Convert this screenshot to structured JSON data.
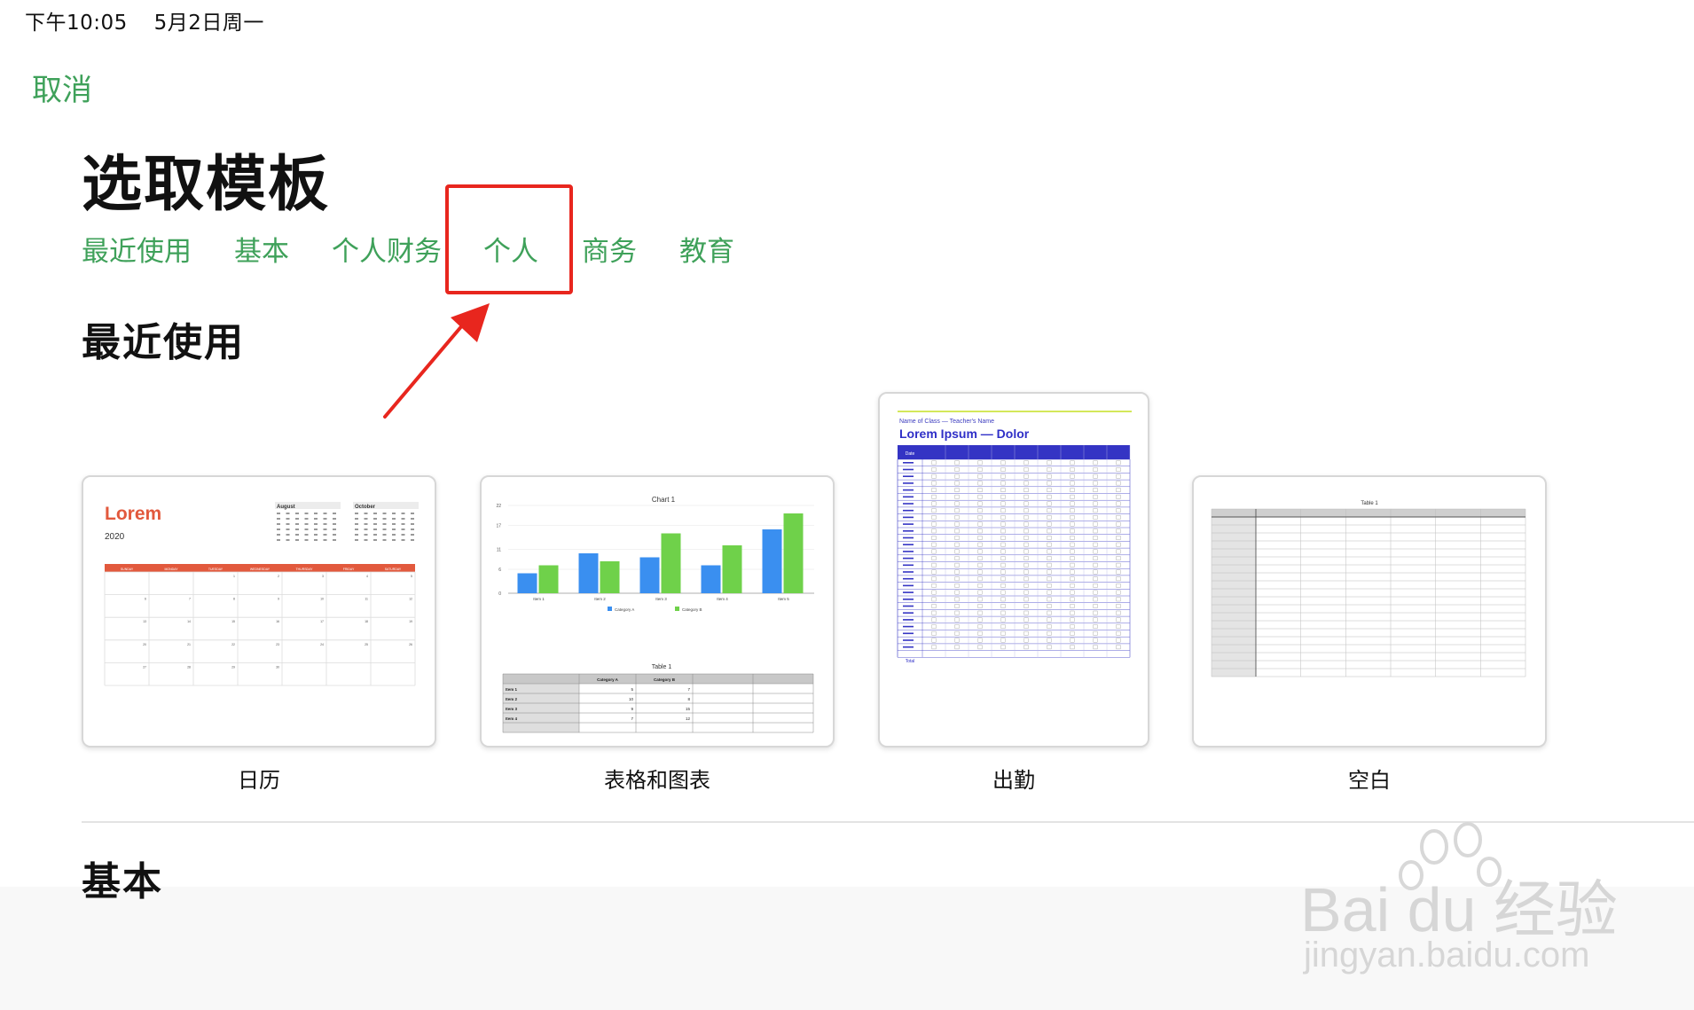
{
  "status_bar": {
    "time": "下午10:05",
    "date": "5月2日周一"
  },
  "nav": {
    "cancel_label": "取消"
  },
  "page_title": "选取模板",
  "tabs": [
    {
      "label": "最近使用"
    },
    {
      "label": "基本"
    },
    {
      "label": "个人财务"
    },
    {
      "label": "个人"
    },
    {
      "label": "商务"
    },
    {
      "label": "教育"
    }
  ],
  "highlighted_tab": "个人",
  "annotation_color": "#e8261e",
  "accent_color": "#3fa15a",
  "sections": {
    "recent": {
      "title": "最近使用",
      "templates": [
        {
          "name": "日历",
          "preview": {
            "heading": "Lorem",
            "year": "2020",
            "mini_months": [
              "August",
              "October"
            ],
            "weekdays": [
              "SUNDAY",
              "MONDAY",
              "TUESDAY",
              "WEDNESDAY",
              "THURSDAY",
              "FRIDAY",
              "SATURDAY"
            ]
          }
        },
        {
          "name": "表格和图表",
          "preview": {
            "chart_title": "Chart 1",
            "table_title": "Table 1",
            "col_a": "Category A",
            "col_b": "Category B",
            "rows": [
              {
                "item": "Item 1",
                "a": "5",
                "b": "7"
              },
              {
                "item": "Item 2",
                "a": "10",
                "b": "8"
              },
              {
                "item": "Item 3",
                "a": "9",
                "b": "15"
              },
              {
                "item": "Item 4",
                "a": "7",
                "b": "12"
              }
            ]
          }
        },
        {
          "name": "出勤",
          "preview": {
            "subtitle": "Name of Class — Teacher's Name",
            "heading": "Lorem Ipsum — Dolor",
            "date_col": "Date",
            "total_label": "Total"
          }
        },
        {
          "name": "空白",
          "preview": {
            "table_title": "Table 1"
          }
        }
      ]
    },
    "basic": {
      "title": "基本"
    }
  },
  "chart_data": {
    "type": "bar",
    "title": "Chart 1",
    "categories": [
      "Item 1",
      "Item 2",
      "Item 3",
      "Item 4",
      "Item 5"
    ],
    "series": [
      {
        "name": "Category A",
        "color": "#3a8ff0",
        "values": [
          5,
          10,
          9,
          7,
          16
        ]
      },
      {
        "name": "Category B",
        "color": "#6fd14a",
        "values": [
          7,
          8,
          15,
          12,
          20
        ]
      }
    ],
    "yticks": [
      0,
      6,
      11,
      17,
      22
    ],
    "ylim": [
      0,
      22
    ],
    "legend": "bottom"
  },
  "watermark": {
    "brand": "Bai du 经验",
    "url": "jingyan.baidu.com"
  }
}
